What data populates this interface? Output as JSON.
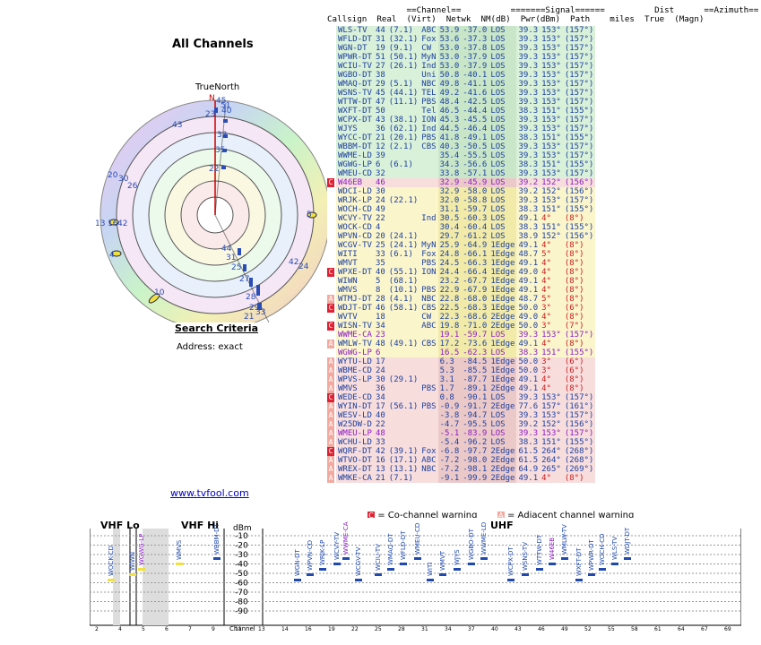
{
  "page": {
    "title": "All Channels",
    "true_north": "TrueNorth",
    "search_title": "Search Criteria",
    "address": "Address: exact",
    "link": "www.tvfool.com",
    "warn_co": "= Co-channel warning",
    "warn_adj": "= Adjacent channel warning"
  },
  "headers": {
    "row1": "                ==Channel==          =======Signal======          Dist      ==Azimuth==",
    "row2": "Callsign  Real  (Virt)  Netwk  NM(dB)  Pwr(dBm)  Path    miles  True  (Magn)"
  },
  "colors": {
    "green": "#d9f0d9",
    "yellow": "#fbf5cc",
    "gray": "#e9e9e9",
    "pink": "#f8dddd",
    "textblue": "#1a3fa0",
    "textred": "#c81d1d",
    "textpurple": "#8a1cc2"
  },
  "rows": [
    {
      "c": "WLS-TV",
      "r": "44",
      "v": "(7.1)",
      "n": "ABC",
      "nm": "53.9",
      "p": "-37.0",
      "path": "LOS",
      "d": "39.3",
      "t": "153°",
      "m": "(157°)",
      "bg": "green",
      "w": ""
    },
    {
      "c": "WFLD-DT",
      "r": "31",
      "v": "(32.1)",
      "n": "Fox",
      "nm": "53.6",
      "p": "-37.3",
      "path": "LOS",
      "d": "39.3",
      "t": "153°",
      "m": "(157°)",
      "bg": "green",
      "w": ""
    },
    {
      "c": "WGN-DT",
      "r": "19",
      "v": "(9.1)",
      "n": "CW",
      "nm": "53.0",
      "p": "-37.8",
      "path": "LOS",
      "d": "39.3",
      "t": "153°",
      "m": "(157°)",
      "bg": "green",
      "w": ""
    },
    {
      "c": "WPWR-DT",
      "r": "51",
      "v": "(50.1)",
      "n": "MyN",
      "nm": "53.0",
      "p": "-37.9",
      "path": "LOS",
      "d": "39.3",
      "t": "153°",
      "m": "(157°)",
      "bg": "green",
      "w": ""
    },
    {
      "c": "WCIU-TV",
      "r": "27",
      "v": "(26.1)",
      "n": "Ind",
      "nm": "53.0",
      "p": "-37.9",
      "path": "LOS",
      "d": "39.3",
      "t": "153°",
      "m": "(157°)",
      "bg": "green",
      "w": ""
    },
    {
      "c": "WGBO-DT",
      "r": "38",
      "v": "",
      "n": "Uni",
      "nm": "50.8",
      "p": "-40.1",
      "path": "LOS",
      "d": "39.3",
      "t": "153°",
      "m": "(157°)",
      "bg": "green",
      "w": ""
    },
    {
      "c": "WMAQ-DT",
      "r": "29",
      "v": "(5.1)",
      "n": "NBC",
      "nm": "49.8",
      "p": "-41.1",
      "path": "LOS",
      "d": "39.3",
      "t": "153°",
      "m": "(157°)",
      "bg": "green",
      "w": ""
    },
    {
      "c": "WSNS-TV",
      "r": "45",
      "v": "(44.1)",
      "n": "TEL",
      "nm": "49.2",
      "p": "-41.6",
      "path": "LOS",
      "d": "39.3",
      "t": "153°",
      "m": "(157°)",
      "bg": "green",
      "w": ""
    },
    {
      "c": "WTTW-DT",
      "r": "47",
      "v": "(11.1)",
      "n": "PBS",
      "nm": "48.4",
      "p": "-42.5",
      "path": "LOS",
      "d": "39.3",
      "t": "153°",
      "m": "(157°)",
      "bg": "green",
      "w": ""
    },
    {
      "c": "WXFT-DT",
      "r": "50",
      "v": "",
      "n": "Tel",
      "nm": "46.5",
      "p": "-44.4",
      "path": "LOS",
      "d": "38.3",
      "t": "151°",
      "m": "(155°)",
      "bg": "green",
      "w": ""
    },
    {
      "c": "WCPX-DT",
      "r": "43",
      "v": "(38.1)",
      "n": "ION",
      "nm": "45.3",
      "p": "-45.5",
      "path": "LOS",
      "d": "39.3",
      "t": "153°",
      "m": "(157°)",
      "bg": "green",
      "w": ""
    },
    {
      "c": "WJYS",
      "r": "36",
      "v": "(62.1)",
      "n": "Ind",
      "nm": "44.5",
      "p": "-46.4",
      "path": "LOS",
      "d": "39.3",
      "t": "153°",
      "m": "(157°)",
      "bg": "green",
      "w": ""
    },
    {
      "c": "WYCC-DT",
      "r": "21",
      "v": "(20.1)",
      "n": "PBS",
      "nm": "41.8",
      "p": "-49.1",
      "path": "LOS",
      "d": "38.3",
      "t": "151°",
      "m": "(155°)",
      "bg": "green",
      "w": ""
    },
    {
      "c": "WBBM-DT",
      "r": "12",
      "v": "(2.1)",
      "n": "CBS",
      "nm": "40.3",
      "p": "-50.5",
      "path": "LOS",
      "d": "39.3",
      "t": "153°",
      "m": "(157°)",
      "bg": "green",
      "w": ""
    },
    {
      "c": "WWME-LD",
      "r": "39",
      "v": "",
      "n": "",
      "nm": "35.4",
      "p": "-55.5",
      "path": "LOS",
      "d": "39.3",
      "t": "153°",
      "m": "(157°)",
      "bg": "green",
      "w": ""
    },
    {
      "c": "WGWG-LP",
      "r": "6",
      "v": "(6.1)",
      "n": "",
      "nm": "34.3",
      "p": "-56.6",
      "path": "LOS",
      "d": "38.3",
      "t": "151°",
      "m": "(155°)",
      "bg": "green",
      "w": ""
    },
    {
      "c": "WMEU-CD",
      "r": "32",
      "v": "",
      "n": "",
      "nm": "33.8",
      "p": "-57.1",
      "path": "LOS",
      "d": "39.3",
      "t": "153°",
      "m": "(157°)",
      "bg": "green",
      "w": ""
    },
    {
      "c": "W46EB",
      "r": "46",
      "v": "",
      "n": "",
      "nm": "32.9",
      "p": "-45.9",
      "path": "LOS",
      "d": "39.2",
      "t": "152°",
      "m": "(156°)",
      "bg": "pink",
      "w": "C",
      "txt": "purple"
    },
    {
      "c": "WDCI-LD",
      "r": "30",
      "v": "",
      "n": "",
      "nm": "32.9",
      "p": "-58.0",
      "path": "LOS",
      "d": "39.2",
      "t": "152°",
      "m": "(156°)",
      "bg": "yellow",
      "w": ""
    },
    {
      "c": "WRJK-LP",
      "r": "24",
      "v": "(22.1)",
      "n": "",
      "nm": "32.0",
      "p": "-58.8",
      "path": "LOS",
      "d": "39.3",
      "t": "153°",
      "m": "(157°)",
      "bg": "yellow",
      "w": ""
    },
    {
      "c": "WOCH-CD",
      "r": "49",
      "v": "",
      "n": "",
      "nm": "31.1",
      "p": "-59.7",
      "path": "LOS",
      "d": "38.3",
      "t": "151°",
      "m": "(155°)",
      "bg": "yellow",
      "w": ""
    },
    {
      "c": "WCVY-TV",
      "r": "22",
      "v": "",
      "n": "Ind",
      "nm": "30.5",
      "p": "-60.3",
      "path": "LOS",
      "d": "49.1",
      "t": "4°",
      "m": "(8°)",
      "bg": "yellow",
      "w": ""
    },
    {
      "c": "WOCK-CD",
      "r": "4",
      "v": "",
      "n": "",
      "nm": "30.4",
      "p": "-60.4",
      "path": "LOS",
      "d": "38.3",
      "t": "151°",
      "m": "(155°)",
      "bg": "yellow",
      "w": ""
    },
    {
      "c": "WPVN-CD",
      "r": "20",
      "v": "(24.1)",
      "n": "",
      "nm": "29.7",
      "p": "-61.2",
      "path": "LOS",
      "d": "38.9",
      "t": "152°",
      "m": "(156°)",
      "bg": "yellow",
      "w": ""
    },
    {
      "c": "WCGV-TV",
      "r": "25",
      "v": "(24.1)",
      "n": "MyN",
      "nm": "25.9",
      "p": "-64.9",
      "path": "1Edge",
      "d": "49.1",
      "t": "4°",
      "m": "(8°)",
      "bg": "yellow",
      "w": ""
    },
    {
      "c": "WITI",
      "r": "33",
      "v": "(6.1)",
      "n": "Fox",
      "nm": "24.8",
      "p": "-66.1",
      "path": "1Edge",
      "d": "48.7",
      "t": "5°",
      "m": "(8°)",
      "bg": "yellow",
      "w": ""
    },
    {
      "c": "WMVT",
      "r": "35",
      "v": "",
      "n": "PBS",
      "nm": "24.5",
      "p": "-66.3",
      "path": "1Edge",
      "d": "49.1",
      "t": "4°",
      "m": "(8°)",
      "bg": "yellow",
      "w": ""
    },
    {
      "c": "WPXE-DT",
      "r": "40",
      "v": "(55.1)",
      "n": "ION",
      "nm": "24.4",
      "p": "-66.4",
      "path": "1Edge",
      "d": "49.0",
      "t": "4°",
      "m": "(8°)",
      "bg": "yellow",
      "w": "C"
    },
    {
      "c": "WIWN",
      "r": "5",
      "v": "(68.1)",
      "n": "",
      "nm": "23.2",
      "p": "-67.7",
      "path": "1Edge",
      "d": "49.1",
      "t": "4°",
      "m": "(8°)",
      "bg": "yellow",
      "w": ""
    },
    {
      "c": "WMVS",
      "r": "8",
      "v": "(10.1)",
      "n": "PBS",
      "nm": "22.9",
      "p": "-67.9",
      "path": "1Edge",
      "d": "49.1",
      "t": "4°",
      "m": "(8°)",
      "bg": "yellow",
      "w": ""
    },
    {
      "c": "WTMJ-DT",
      "r": "28",
      "v": "(4.1)",
      "n": "NBC",
      "nm": "22.8",
      "p": "-68.0",
      "path": "1Edge",
      "d": "48.7",
      "t": "5°",
      "m": "(8°)",
      "bg": "yellow",
      "w": "A"
    },
    {
      "c": "WDJT-DT",
      "r": "46",
      "v": "(58.1)",
      "n": "CBS",
      "nm": "22.5",
      "p": "-68.3",
      "path": "1Edge",
      "d": "50.0",
      "t": "3°",
      "m": "(6°)",
      "bg": "yellow",
      "w": "C"
    },
    {
      "c": "WVTV",
      "r": "18",
      "v": "",
      "n": "CW",
      "nm": "22.3",
      "p": "-68.6",
      "path": "2Edge",
      "d": "49.0",
      "t": "4°",
      "m": "(8°)",
      "bg": "yellow",
      "w": ""
    },
    {
      "c": "WISN-TV",
      "r": "34",
      "v": "",
      "n": "ABC",
      "nm": "19.8",
      "p": "-71.0",
      "path": "2Edge",
      "d": "50.0",
      "t": "3°",
      "m": "(7°)",
      "bg": "yellow",
      "w": "C"
    },
    {
      "c": "WWME-CA",
      "r": "23",
      "v": "",
      "n": "",
      "nm": "19.1",
      "p": "-59.7",
      "path": "LOS",
      "d": "39.3",
      "t": "153°",
      "m": "(157°)",
      "bg": "yellow",
      "w": "",
      "txt": "purple"
    },
    {
      "c": "WMLW-TV",
      "r": "48",
      "v": "(49.1)",
      "n": "CBS",
      "nm": "17.2",
      "p": "-73.6",
      "path": "1Edge",
      "d": "49.1",
      "t": "4°",
      "m": "(8°)",
      "bg": "yellow",
      "w": "AC"
    },
    {
      "c": "WGWG-LP",
      "r": "6",
      "v": "",
      "n": "",
      "nm": "16.5",
      "p": "-62.3",
      "path": "LOS",
      "d": "38.3",
      "t": "151°",
      "m": "(155°)",
      "bg": "yellow",
      "w": "",
      "txt": "purple"
    },
    {
      "c": "WYTU-LD",
      "r": "17",
      "v": "",
      "n": "",
      "nm": "6.3",
      "p": "-84.5",
      "path": "1Edge",
      "d": "50.0",
      "t": "3°",
      "m": "(6°)",
      "bg": "pink",
      "w": "AC"
    },
    {
      "c": "WBME-CD",
      "r": "24",
      "v": "",
      "n": "",
      "nm": "5.3",
      "p": "-85.5",
      "path": "1Edge",
      "d": "50.0",
      "t": "3°",
      "m": "(6°)",
      "bg": "pink",
      "w": "AC"
    },
    {
      "c": "WPVS-LP",
      "r": "30",
      "v": "(29.1)",
      "n": "",
      "nm": "3.1",
      "p": "-87.7",
      "path": "1Edge",
      "d": "49.1",
      "t": "4°",
      "m": "(8°)",
      "bg": "pink",
      "w": "AC"
    },
    {
      "c": "WMVS",
      "r": "36",
      "v": "",
      "n": "PBS",
      "nm": "1.7",
      "p": "-89.1",
      "path": "2Edge",
      "d": "49.1",
      "t": "4°",
      "m": "(8°)",
      "bg": "pink",
      "w": "AC"
    },
    {
      "c": "WEDE-CD",
      "r": "34",
      "v": "",
      "n": "",
      "nm": "0.8",
      "p": "-90.1",
      "path": "LOS",
      "d": "39.3",
      "t": "153°",
      "m": "(157°)",
      "bg": "pink",
      "w": "C"
    },
    {
      "c": "WYIN-DT",
      "r": "17",
      "v": "(56.1)",
      "n": "PBS",
      "nm": "-0.9",
      "p": "-91.7",
      "path": "2Edge",
      "d": "77.6",
      "t": "157°",
      "m": "(161°)",
      "bg": "pink",
      "w": "AC"
    },
    {
      "c": "WESV-LD",
      "r": "40",
      "v": "",
      "n": "",
      "nm": "-3.8",
      "p": "-94.7",
      "path": "LOS",
      "d": "39.3",
      "t": "153°",
      "m": "(157°)",
      "bg": "pink",
      "w": "AC"
    },
    {
      "c": "W25DW-D",
      "r": "22",
      "v": "",
      "n": "",
      "nm": "-4.7",
      "p": "-95.5",
      "path": "LOS",
      "d": "39.2",
      "t": "152°",
      "m": "(156°)",
      "bg": "pink",
      "w": "AC"
    },
    {
      "c": "WMEU-LP",
      "r": "48",
      "v": "",
      "n": "",
      "nm": "-5.1",
      "p": "-83.9",
      "path": "LOS",
      "d": "39.3",
      "t": "153°",
      "m": "(157°)",
      "bg": "pink",
      "w": "AC",
      "txt": "purple"
    },
    {
      "c": "WCHU-LD",
      "r": "33",
      "v": "",
      "n": "",
      "nm": "-5.4",
      "p": "-96.2",
      "path": "LOS",
      "d": "38.3",
      "t": "151°",
      "m": "(155°)",
      "bg": "pink",
      "w": "AC"
    },
    {
      "c": "WQRF-DT",
      "r": "42",
      "v": "(39.1)",
      "n": "Fox",
      "nm": "-6.8",
      "p": "-97.7",
      "path": "2Edge",
      "d": "61.5",
      "t": "264°",
      "m": "(268°)",
      "bg": "pink",
      "w": "C"
    },
    {
      "c": "WTVO-DT",
      "r": "16",
      "v": "(17.1)",
      "n": "ABC",
      "nm": "-7.2",
      "p": "-98.0",
      "path": "2Edge",
      "d": "61.5",
      "t": "264°",
      "m": "(268°)",
      "bg": "pink",
      "w": "AC"
    },
    {
      "c": "WREX-DT",
      "r": "13",
      "v": "(13.1)",
      "n": "NBC",
      "nm": "-7.2",
      "p": "-98.1",
      "path": "2Edge",
      "d": "64.9",
      "t": "265°",
      "m": "(269°)",
      "bg": "pink",
      "w": "AC"
    },
    {
      "c": "WMKE-CA",
      "r": "21",
      "v": "(7.1)",
      "n": "",
      "nm": "-9.1",
      "p": "-99.9",
      "path": "2Edge",
      "d": "49.1",
      "t": "4°",
      "m": "(8°)",
      "bg": "pink",
      "w": "AC"
    }
  ],
  "polar": {
    "labels": [
      "45",
      "51",
      "23",
      "40",
      "43",
      "33",
      "35",
      "22",
      "20",
      "30",
      "26",
      "5",
      "13",
      "16",
      "42",
      "44",
      "31",
      "25",
      "42",
      "24",
      "10",
      "27",
      "28",
      "29",
      "21",
      "33"
    ],
    "rings": 6
  },
  "spectrum": {
    "title_vhf_lo": "VHF Lo",
    "title_vhf_hi": "VHF Hi",
    "title_uhf": "UHF",
    "dbm": "dBm",
    "channel": "Channel",
    "y_ticks": [
      "-10",
      "-20",
      "-30",
      "-40",
      "-50",
      "-60",
      "-70",
      "-80",
      "-90"
    ],
    "ch_ticks": [
      "2",
      "4",
      "5",
      "6",
      "7",
      "9",
      "11",
      "13",
      "14",
      "16",
      "19",
      "22",
      "25",
      "28",
      "31",
      "34",
      "37",
      "40",
      "43",
      "46",
      "49",
      "52",
      "55",
      "58",
      "61",
      "64",
      "67",
      "69"
    ],
    "labels_top": [
      "WOCK-CD",
      "WIWN",
      "WGWG-LP",
      "WMVS",
      "WBBM-DT",
      "WGN-DT",
      "WPVN-CD",
      "WRJK-LP",
      "WCVY-TV",
      "WWME-CA",
      "WCGV-TV",
      "WCIU-TV",
      "WMAQ-DT",
      "WFLD-DT",
      "WMEU-CD",
      "WITI",
      "WMVT",
      "WJYS",
      "WGBO-DT",
      "WWME-LD",
      "WCPX-DT",
      "WSNS-TV",
      "WTTW-DT",
      "W46EB",
      "WMLW-TV",
      "WXFT-DT",
      "WPWR-DT",
      "WOCH-CD",
      "WLS-TV",
      "WDJT-DT"
    ]
  }
}
